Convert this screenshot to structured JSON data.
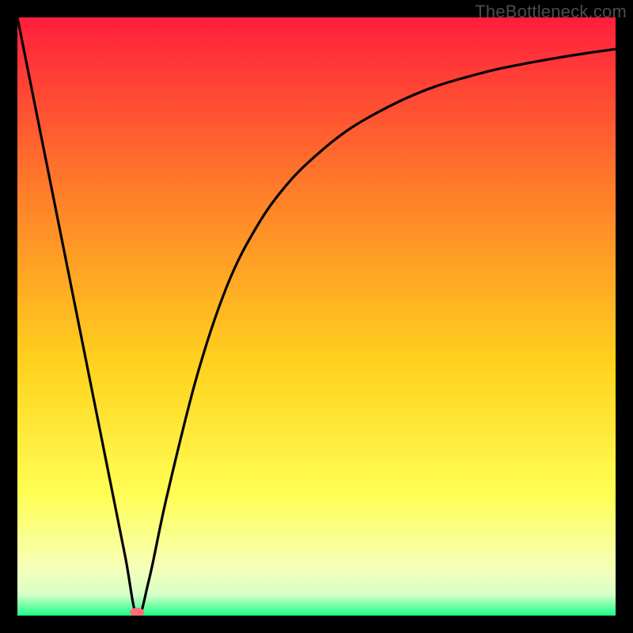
{
  "watermark": {
    "text": "TheBottleneck.com"
  },
  "colors": {
    "top": "#ff1e3c",
    "upper": "#ff7a2a",
    "mid": "#ffd21e",
    "lower": "#ffff55",
    "pale": "#f5ffb8",
    "bottom": "#1aff88",
    "curve": "#000000",
    "marker": "#ff6f7a",
    "frame": "#000000"
  },
  "chart_data": {
    "type": "line",
    "title": "",
    "xlabel": "",
    "ylabel": "",
    "xlim": [
      0,
      100
    ],
    "ylim": [
      0,
      100
    ],
    "grid": false,
    "legend": false,
    "series": [
      {
        "name": "bottleneck-curve",
        "x": [
          0,
          5,
          10,
          15,
          18,
          20,
          22,
          25,
          30,
          35,
          40,
          45,
          50,
          55,
          60,
          65,
          70,
          75,
          80,
          85,
          90,
          95,
          100
        ],
        "values": [
          100,
          75,
          50,
          25,
          10,
          0,
          6,
          20,
          40,
          55,
          65,
          72,
          77,
          81,
          84,
          86.5,
          88.5,
          90,
          91.3,
          92.3,
          93.2,
          94,
          94.7
        ]
      }
    ],
    "marker": {
      "x": 20,
      "y": 0
    },
    "gradient_stops": [
      {
        "offset": 0.0,
        "color": "#ff1e3c"
      },
      {
        "offset": 0.28,
        "color": "#ff7a2a"
      },
      {
        "offset": 0.58,
        "color": "#ffd21e"
      },
      {
        "offset": 0.8,
        "color": "#ffff55"
      },
      {
        "offset": 0.92,
        "color": "#f5ffb8"
      },
      {
        "offset": 0.965,
        "color": "#d8ffc8"
      },
      {
        "offset": 1.0,
        "color": "#1aff88"
      }
    ]
  }
}
